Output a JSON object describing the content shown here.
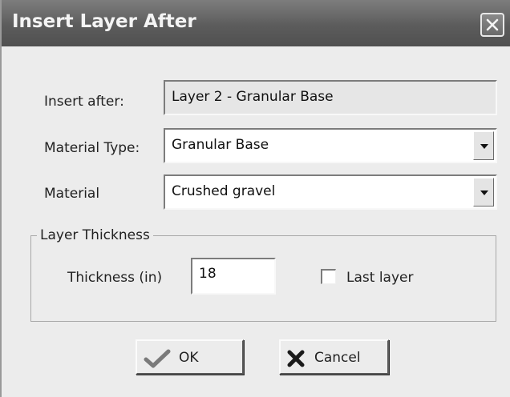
{
  "window": {
    "title": "Insert Layer After"
  },
  "form": {
    "insert_after_label": "Insert after:",
    "insert_after_value": "Layer 2 - Granular Base",
    "material_type_label": "Material Type:",
    "material_type_value": "Granular Base",
    "material_label": "Material",
    "material_value": "Crushed gravel"
  },
  "thickness_group": {
    "title": "Layer Thickness",
    "thickness_label": "Thickness (in)",
    "thickness_value": "18",
    "last_layer_label": "Last layer",
    "last_layer_checked": false
  },
  "buttons": {
    "ok_label": "OK",
    "cancel_label": "Cancel"
  },
  "icons": {
    "close": "close-icon",
    "ok": "checkmark-icon",
    "cancel": "x-mark-icon",
    "dropdown": "chevron-down-icon"
  }
}
